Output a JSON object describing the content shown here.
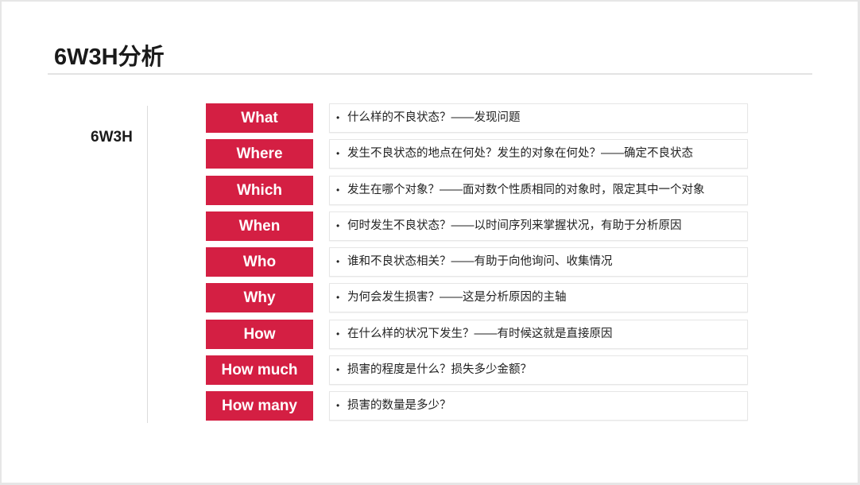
{
  "slide": {
    "title": "6W3H分析",
    "group_label": "6W3H",
    "accent_color": "#d41f43",
    "bullet_glyph": "•",
    "rows": [
      {
        "tag": "What",
        "text": "什么样的不良状态？——发现问题"
      },
      {
        "tag": "Where",
        "text": "发生不良状态的地点在何处？发生的对象在何处？——确定不良状态"
      },
      {
        "tag": "Which",
        "text": "发生在哪个对象？——面对数个性质相同的对象时，限定其中一个对象"
      },
      {
        "tag": "When",
        "text": "何时发生不良状态？——以时间序列来掌握状况，有助于分析原因"
      },
      {
        "tag": "Who",
        "text": "谁和不良状态相关？——有助于向他询问、收集情况"
      },
      {
        "tag": "Why",
        "text": "为何会发生损害？——这是分析原因的主轴"
      },
      {
        "tag": "How",
        "text": "在什么样的状况下发生？——有时候这就是直接原因"
      },
      {
        "tag": "How much",
        "text": "损害的程度是什么？损失多少金额？"
      },
      {
        "tag": "How many",
        "text": "损害的数量是多少？"
      }
    ]
  }
}
